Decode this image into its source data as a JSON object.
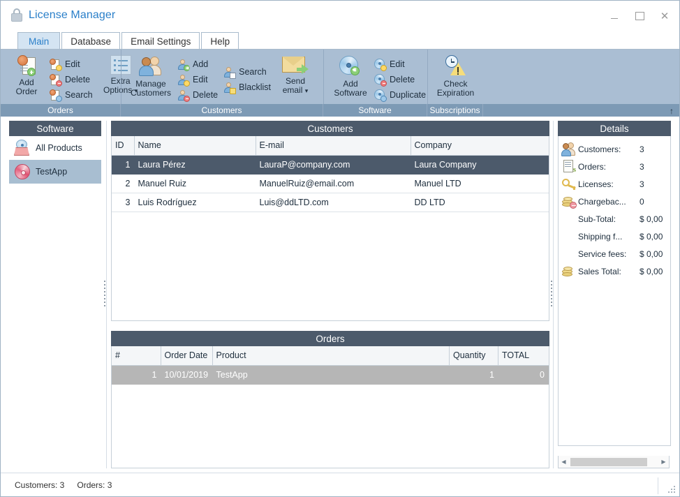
{
  "window": {
    "title": "License Manager",
    "icon": "lock-icon",
    "controls": {
      "minimize": "–",
      "maximize": "□",
      "close": "✕"
    }
  },
  "tabs": [
    {
      "label": "Main",
      "active": true
    },
    {
      "label": "Database",
      "active": false
    },
    {
      "label": "Email Settings",
      "active": false
    },
    {
      "label": "Help",
      "active": false
    }
  ],
  "ribbon": {
    "collapse_arrow": "↑",
    "groups": [
      {
        "name": "Orders",
        "big": [
          {
            "label_line1": "Add",
            "label_line2": "Order",
            "icon": "add-order-icon"
          }
        ],
        "small": [
          {
            "label": "Edit",
            "icon": "edit-order-icon"
          },
          {
            "label": "Delete",
            "icon": "delete-order-icon"
          },
          {
            "label": "Search",
            "icon": "search-order-icon"
          }
        ],
        "extra": {
          "label_line1": "Extra",
          "label_line2": "Options",
          "dropdown": "▾",
          "icon": "extra-options-icon"
        }
      },
      {
        "name": "Customers",
        "big": [
          {
            "label_line1": "Manage",
            "label_line2": "Customers",
            "icon": "manage-customers-icon"
          }
        ],
        "small": [
          {
            "label": "Add",
            "icon": "add-customer-icon"
          },
          {
            "label": "Edit",
            "icon": "edit-customer-icon"
          },
          {
            "label": "Delete",
            "icon": "delete-customer-icon"
          }
        ],
        "small2": [
          {
            "label": "Search",
            "icon": "search-customer-icon"
          },
          {
            "label": "Blacklist",
            "icon": "blacklist-customer-icon"
          }
        ],
        "mail": {
          "label_line1": "Send",
          "label_line2": "email",
          "dropdown": "▾",
          "icon": "send-email-icon"
        }
      },
      {
        "name": "Software",
        "big": [
          {
            "label_line1": "Add",
            "label_line2": "Software",
            "icon": "add-software-icon"
          }
        ],
        "small": [
          {
            "label": "Edit",
            "icon": "edit-software-icon"
          },
          {
            "label": "Delete",
            "icon": "delete-software-icon"
          },
          {
            "label": "Duplicate",
            "icon": "duplicate-software-icon"
          }
        ]
      },
      {
        "name": "Subscriptions",
        "big": [
          {
            "label_line1": "Check",
            "label_line2": "Expiration",
            "icon": "check-expiration-icon"
          }
        ]
      }
    ]
  },
  "sidebar": {
    "header": "Software",
    "items": [
      {
        "label": "All Products",
        "icon": "all-products-icon",
        "selected": false
      },
      {
        "label": "TestApp",
        "icon": "product-disc-icon",
        "selected": true
      }
    ]
  },
  "customers_panel": {
    "header": "Customers",
    "columns": [
      "ID",
      "Name",
      "E-mail",
      "Company"
    ],
    "rows": [
      {
        "id": "1",
        "name": "Laura Pérez",
        "email": "LauraP@company.com",
        "company": "Laura Company",
        "selected": true
      },
      {
        "id": "2",
        "name": "Manuel Ruiz",
        "email": "ManuelRuiz@email.com",
        "company": "Manuel LTD",
        "selected": false
      },
      {
        "id": "3",
        "name": "Luis Rodríguez",
        "email": "Luis@ddLTD.com",
        "company": "DD LTD",
        "selected": false
      }
    ]
  },
  "orders_panel": {
    "header": "Orders",
    "columns": [
      "#",
      "Order Date",
      "Product",
      "Quantity",
      "TOTAL"
    ],
    "rows": [
      {
        "num": "1",
        "date": "10/01/2019",
        "product": "TestApp",
        "quantity": "1",
        "total": "0",
        "selected": true
      }
    ]
  },
  "details_panel": {
    "header": "Details",
    "rows": [
      {
        "label": "Customers:",
        "value": "3",
        "icon": "people-icon"
      },
      {
        "label": "Orders:",
        "value": "3",
        "icon": "order-doc-icon"
      },
      {
        "label": "Licenses:",
        "value": "3",
        "icon": "key-icon"
      },
      {
        "label": "Chargebac...",
        "value": "0",
        "icon": "chargeback-coins-icon"
      },
      {
        "label": "Sub-Total:",
        "value": "$ 0,00",
        "icon": ""
      },
      {
        "label": "Shipping f...",
        "value": "$ 0,00",
        "icon": ""
      },
      {
        "label": "Service fees:",
        "value": "$ 0,00",
        "icon": ""
      },
      {
        "label": "Sales Total:",
        "value": "$ 0,00",
        "icon": "coins-icon"
      }
    ],
    "scroll_left": "◀",
    "scroll_right": "▶"
  },
  "statusbar": {
    "customers": "Customers: 3",
    "orders": "Orders: 3"
  },
  "colors": {
    "accent_blue": "#2a7fc9",
    "ribbon_bg": "#aabed3",
    "group_label_bg": "#7d9ab5",
    "panel_header_bg": "#4c5a6b",
    "selection_dark": "#4c5a6b",
    "selection_gray": "#b6b6b6",
    "sidebar_selected": "#a8bed1"
  }
}
